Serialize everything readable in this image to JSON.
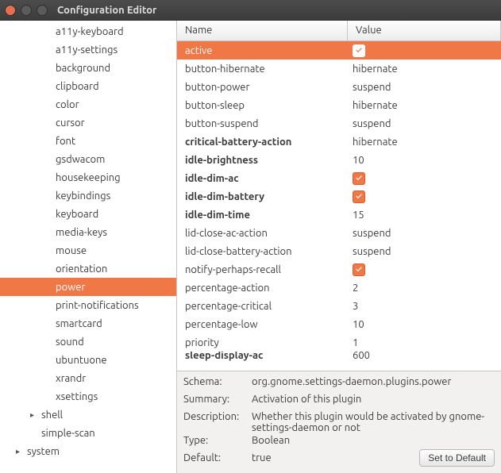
{
  "titlebar": {
    "title": "Configuration Editor"
  },
  "sidebar": {
    "items": [
      {
        "label": "a11y-keyboard",
        "depth": 2,
        "expandable": false
      },
      {
        "label": "a11y-settings",
        "depth": 2,
        "expandable": false
      },
      {
        "label": "background",
        "depth": 2,
        "expandable": false
      },
      {
        "label": "clipboard",
        "depth": 2,
        "expandable": false
      },
      {
        "label": "color",
        "depth": 2,
        "expandable": false
      },
      {
        "label": "cursor",
        "depth": 2,
        "expandable": false
      },
      {
        "label": "font",
        "depth": 2,
        "expandable": false
      },
      {
        "label": "gsdwacom",
        "depth": 2,
        "expandable": false
      },
      {
        "label": "housekeeping",
        "depth": 2,
        "expandable": false
      },
      {
        "label": "keybindings",
        "depth": 2,
        "expandable": false
      },
      {
        "label": "keyboard",
        "depth": 2,
        "expandable": false
      },
      {
        "label": "media-keys",
        "depth": 2,
        "expandable": false
      },
      {
        "label": "mouse",
        "depth": 2,
        "expandable": false
      },
      {
        "label": "orientation",
        "depth": 2,
        "expandable": false
      },
      {
        "label": "power",
        "depth": 2,
        "expandable": false,
        "selected": true
      },
      {
        "label": "print-notifications",
        "depth": 2,
        "expandable": false
      },
      {
        "label": "smartcard",
        "depth": 2,
        "expandable": false
      },
      {
        "label": "sound",
        "depth": 2,
        "expandable": false
      },
      {
        "label": "ubuntuone",
        "depth": 2,
        "expandable": false
      },
      {
        "label": "xrandr",
        "depth": 2,
        "expandable": false
      },
      {
        "label": "xsettings",
        "depth": 2,
        "expandable": false
      },
      {
        "label": "shell",
        "depth": 1,
        "expandable": true
      },
      {
        "label": "simple-scan",
        "depth": 1,
        "expandable": false
      },
      {
        "label": "system",
        "depth": 0,
        "expandable": true
      }
    ]
  },
  "table": {
    "headers": {
      "name": "Name",
      "value": "Value"
    },
    "rows": [
      {
        "name": "active",
        "type": "check",
        "value": true,
        "bold": false,
        "selected": true
      },
      {
        "name": "button-hibernate",
        "type": "text",
        "value": "hibernate",
        "bold": false
      },
      {
        "name": "button-power",
        "type": "text",
        "value": "suspend",
        "bold": false
      },
      {
        "name": "button-sleep",
        "type": "text",
        "value": "hibernate",
        "bold": false
      },
      {
        "name": "button-suspend",
        "type": "text",
        "value": "suspend",
        "bold": false
      },
      {
        "name": "critical-battery-action",
        "type": "text",
        "value": "hibernate",
        "bold": true
      },
      {
        "name": "idle-brightness",
        "type": "text",
        "value": "10",
        "bold": true
      },
      {
        "name": "idle-dim-ac",
        "type": "check",
        "value": true,
        "bold": true
      },
      {
        "name": "idle-dim-battery",
        "type": "check",
        "value": true,
        "bold": true
      },
      {
        "name": "idle-dim-time",
        "type": "text",
        "value": "15",
        "bold": true
      },
      {
        "name": "lid-close-ac-action",
        "type": "text",
        "value": "suspend",
        "bold": false
      },
      {
        "name": "lid-close-battery-action",
        "type": "text",
        "value": "suspend",
        "bold": false
      },
      {
        "name": "notify-perhaps-recall",
        "type": "check",
        "value": true,
        "bold": false
      },
      {
        "name": "percentage-action",
        "type": "text",
        "value": "2",
        "bold": false
      },
      {
        "name": "percentage-critical",
        "type": "text",
        "value": "3",
        "bold": false
      },
      {
        "name": "percentage-low",
        "type": "text",
        "value": "10",
        "bold": false
      },
      {
        "name": "priority",
        "type": "text",
        "value": "1",
        "bold": false
      },
      {
        "name": "sleep-display-ac",
        "type": "text",
        "value": "600",
        "bold": true,
        "clipped": true
      }
    ]
  },
  "details": {
    "schema_label": "Schema:",
    "schema_value": "org.gnome.settings-daemon.plugins.power",
    "summary_label": "Summary:",
    "summary_value": "Activation of this plugin",
    "description_label": "Description:",
    "description_value": "Whether this plugin would be activated by gnome-settings-daemon or not",
    "type_label": "Type:",
    "type_value": "Boolean",
    "default_label": "Default:",
    "default_value": "true",
    "set_default_label": "Set to Default"
  }
}
